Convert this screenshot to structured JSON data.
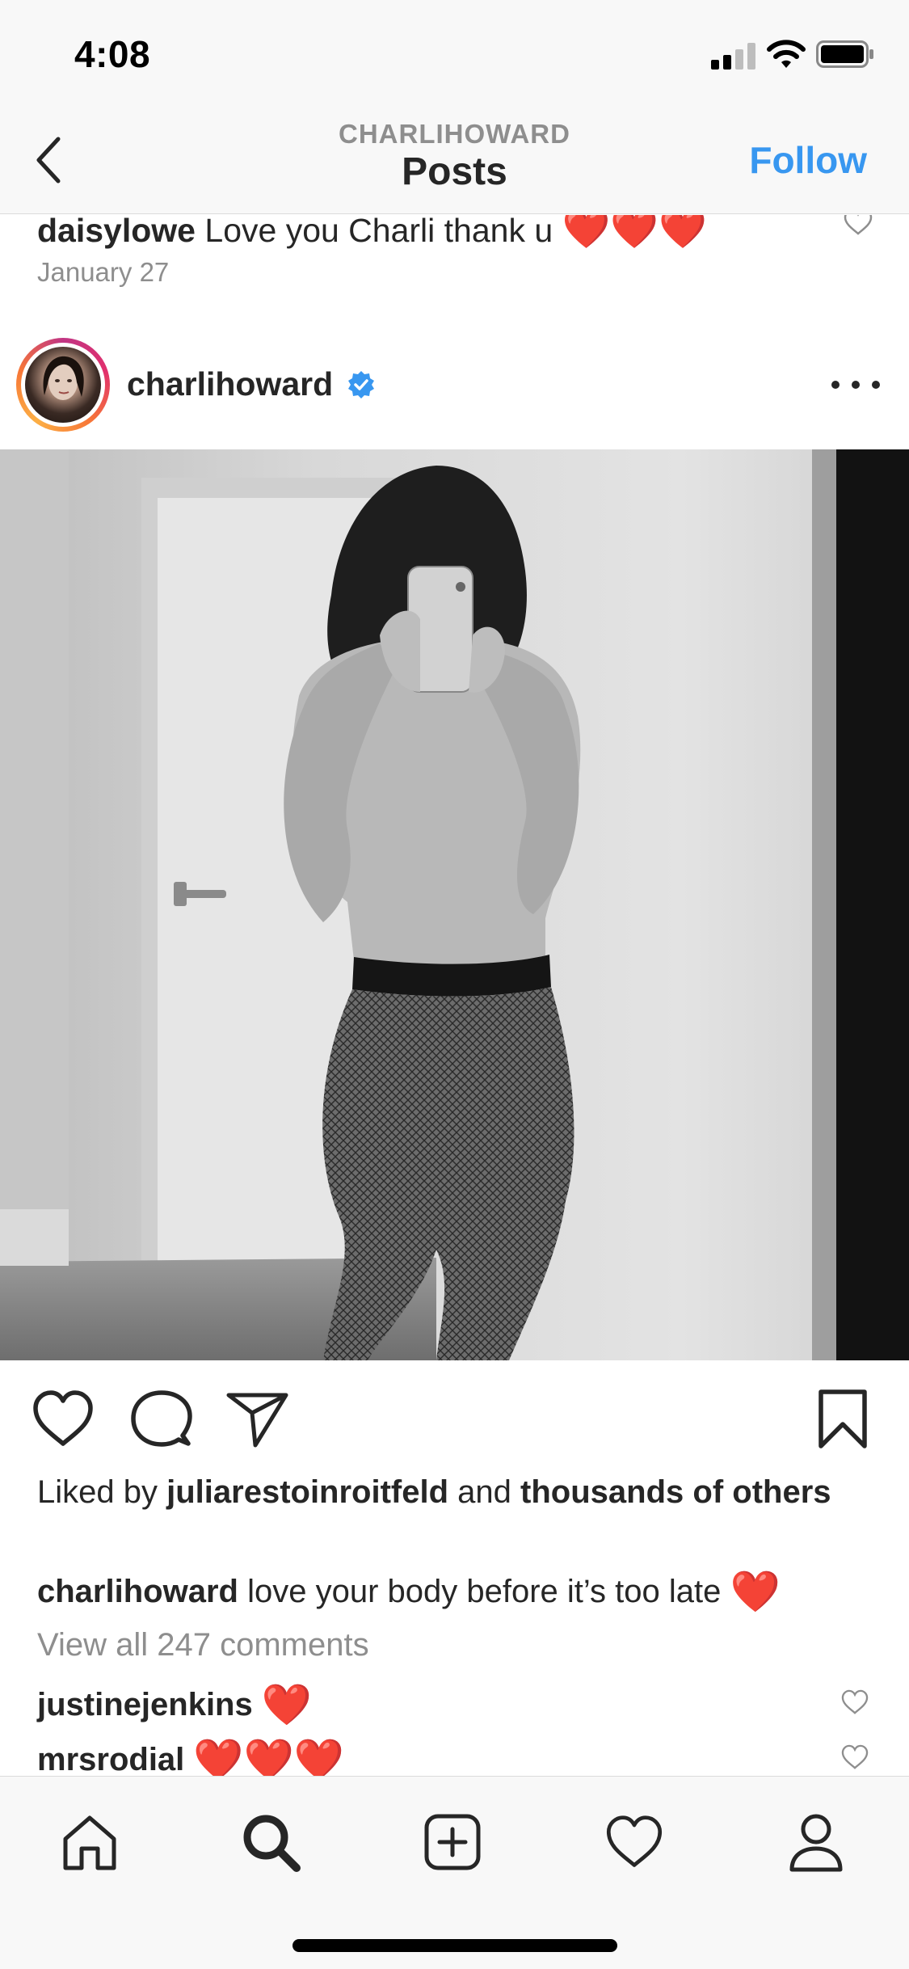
{
  "status_bar": {
    "time": "4:08"
  },
  "nav": {
    "username": "CHARLIHOWARD",
    "title": "Posts",
    "follow_label": "Follow"
  },
  "previous_comment": {
    "username": "daisylowe",
    "text": "Love you Charli thank u",
    "emoji": "❤️❤️❤️",
    "date": "January 27"
  },
  "post": {
    "username": "charlihoward",
    "verified": true,
    "likes_prefix": "Liked by",
    "liked_by_user": "juliarestoinroitfeld",
    "likes_and": "and",
    "likes_others": "thousands of others",
    "caption_username": "charlihoward",
    "caption_text": "love your body before it’s too late",
    "caption_emoji": "❤️",
    "view_all_comments": "View all 247 comments",
    "comments": [
      {
        "username": "justinejenkins",
        "text": "❤️"
      },
      {
        "username": "mrsrodial",
        "text": "❤️❤️❤️"
      }
    ]
  },
  "icons": {
    "back": "chevron-left-icon",
    "like": "heart-outline-icon",
    "comment": "comment-bubble-icon",
    "share": "paper-plane-icon",
    "save": "bookmark-icon",
    "tabs": [
      "home-icon",
      "search-icon",
      "add-post-icon",
      "activity-heart-icon",
      "profile-icon"
    ]
  },
  "colors": {
    "accent": "#3897f0",
    "heart": "#ed4956",
    "muted": "#8e8e8e",
    "text": "#262626",
    "verified": "#3897f0"
  }
}
